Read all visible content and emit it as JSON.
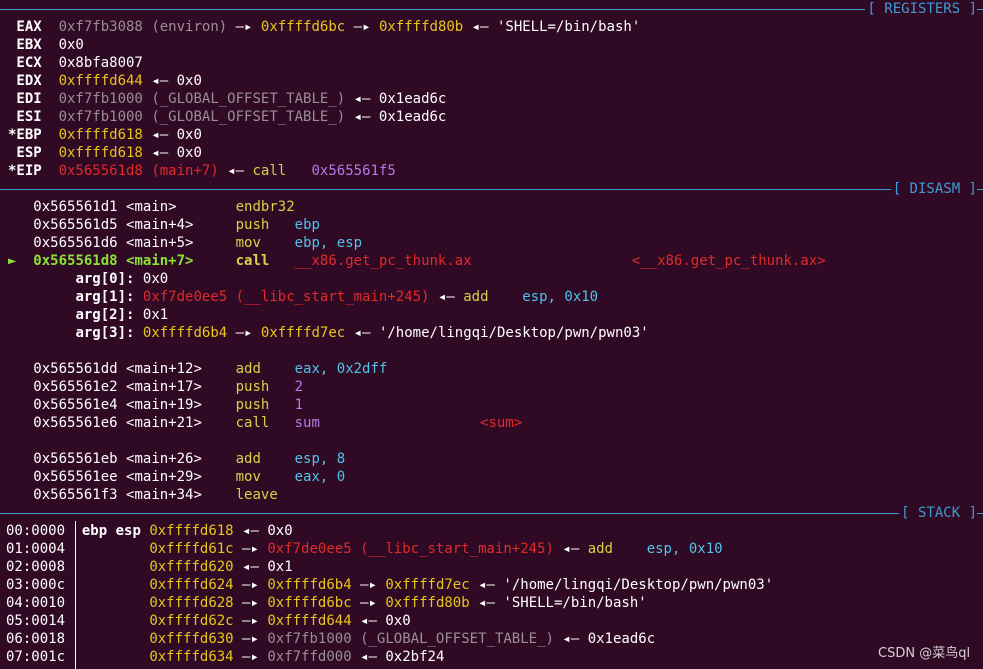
{
  "sections": {
    "registers": "[ REGISTERS ]",
    "disasm": "[ DISASM ]",
    "stack": "[ STACK ]"
  },
  "arrow": "—▸",
  "larrow": "◂—",
  "registers": [
    {
      "name": " EAX",
      "v1": "0xf7fb3088",
      "s1": "(environ)",
      "v2": "0xffffd6bc",
      "v3": "0xffffd80b",
      "v4": "'SHELL=/bin/bash'"
    },
    {
      "name": " EBX",
      "v1": "0x0"
    },
    {
      "name": " ECX",
      "v1": "0x8bfa8007"
    },
    {
      "name": " EDX",
      "v1": "0xffffd644",
      "v2": "0x0"
    },
    {
      "name": " EDI",
      "v1": "0xf7fb1000",
      "s1": "(_GLOBAL_OFFSET_TABLE_)",
      "v2": "0x1ead6c"
    },
    {
      "name": " ESI",
      "v1": "0xf7fb1000",
      "s1": "(_GLOBAL_OFFSET_TABLE_)",
      "v2": "0x1ead6c"
    },
    {
      "name": "*EBP",
      "v1": "0xffffd618",
      "v2": "0x0"
    },
    {
      "name": " ESP",
      "v1": "0xffffd618",
      "v2": "0x0"
    },
    {
      "name": "*EIP",
      "v1": "0x565561d8",
      "s1": "(main+7)",
      "ins": "call",
      "op": "0x565561f5"
    }
  ],
  "disasm": [
    {
      "addr": "0x565561d1",
      "sym": "<main>",
      "mn": "endbr32",
      "op": ""
    },
    {
      "addr": "0x565561d5",
      "sym": "<main+4>",
      "mn": "push",
      "op": "ebp"
    },
    {
      "addr": "0x565561d6",
      "sym": "<main+5>",
      "mn": "mov",
      "op": "ebp, esp"
    },
    {
      "addr": "0x565561d8",
      "sym": "<main+7>",
      "mn": "call",
      "op": "__x86.get_pc_thunk.ax",
      "cm": "<__x86.get_pc_thunk.ax>",
      "cur": "►"
    },
    {
      "addr": "0x565561dd",
      "sym": "<main+12>",
      "mn": "add",
      "op": "eax, 0x2dff"
    },
    {
      "addr": "0x565561e2",
      "sym": "<main+17>",
      "mn": "push",
      "op": "2"
    },
    {
      "addr": "0x565561e4",
      "sym": "<main+19>",
      "mn": "push",
      "op": "1"
    },
    {
      "addr": "0x565561e6",
      "sym": "<main+21>",
      "mn": "call",
      "op": "sum",
      "cm": "<sum>"
    },
    {
      "addr": "0x565561eb",
      "sym": "<main+26>",
      "mn": "add",
      "op": "esp, 8"
    },
    {
      "addr": "0x565561ee",
      "sym": "<main+29>",
      "mn": "mov",
      "op": "eax, 0"
    },
    {
      "addr": "0x565561f3",
      "sym": "<main+34>",
      "mn": "leave",
      "op": ""
    }
  ],
  "args": [
    {
      "label": "arg[0]:",
      "v1": "0x0"
    },
    {
      "label": "arg[1]:",
      "v1": "0xf7de0ee5",
      "s1": "(__libc_start_main+245)",
      "ins": "add",
      "op": "esp, 0x10"
    },
    {
      "label": "arg[2]:",
      "v1": "0x1"
    },
    {
      "label": "arg[3]:",
      "v1": "0xffffd6b4",
      "v2": "0xffffd7ec",
      "v3": "'/home/lingqi/Desktop/pwn/pwn03'"
    }
  ],
  "stack": [
    {
      "off": "00:0000",
      "regs": "ebp esp",
      "addr": "0xffffd618",
      "v1": "0x0"
    },
    {
      "off": "01:0004",
      "regs": "",
      "addr": "0xffffd61c",
      "v1": "0xf7de0ee5",
      "s1": "(__libc_start_main+245)",
      "ins": "add",
      "op": "esp, 0x10"
    },
    {
      "off": "02:0008",
      "regs": "",
      "addr": "0xffffd620",
      "v1": "0x1"
    },
    {
      "off": "03:000c",
      "regs": "",
      "addr": "0xffffd624",
      "v1": "0xffffd6b4",
      "v2": "0xffffd7ec",
      "v3": "'/home/lingqi/Desktop/pwn/pwn03'"
    },
    {
      "off": "04:0010",
      "regs": "",
      "addr": "0xffffd628",
      "v1": "0xffffd6bc",
      "v2": "0xffffd80b",
      "v3": "'SHELL=/bin/bash'"
    },
    {
      "off": "05:0014",
      "regs": "",
      "addr": "0xffffd62c",
      "v1": "0xffffd644",
      "v2": "0x0"
    },
    {
      "off": "06:0018",
      "regs": "",
      "addr": "0xffffd630",
      "v1": "0xf7fb1000",
      "s1": "(_GLOBAL_OFFSET_TABLE_)",
      "v2": "0x1ead6c"
    },
    {
      "off": "07:001c",
      "regs": "",
      "addr": "0xffffd634",
      "v1": "0xf7ffd000",
      "v2": "0x2bf24"
    }
  ],
  "watermark": "CSDN @菜鸟ql",
  "colors": {
    "background": "#300a24",
    "separator": "#3f9bd6",
    "heap": "#e8c51a",
    "code": "#e02a2a",
    "data": "#9b8d97",
    "current": "#8ae234",
    "register": "#4fc3e8",
    "number": "#b878e8"
  }
}
